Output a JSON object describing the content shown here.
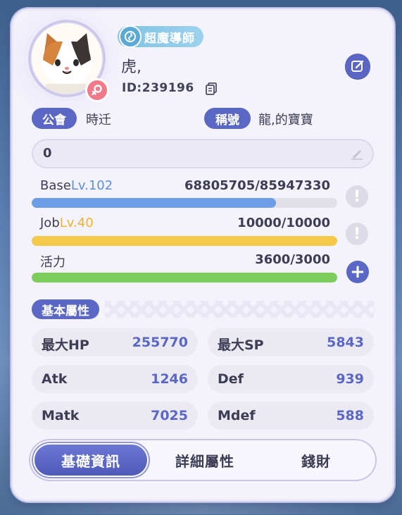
{
  "profile": {
    "job_title": "超魔導師",
    "name": "虎,",
    "id_text": "ID:239196",
    "gender": "female"
  },
  "guild": {
    "label": "公會",
    "value": "時迁"
  },
  "title": {
    "label": "稱號",
    "value": "龍,的寶寶"
  },
  "signature": {
    "text": "0"
  },
  "stats": {
    "base": {
      "label": "Base",
      "level_text": "Lv.102",
      "value_text": "68805705/85947330",
      "progress": 0.8,
      "color": "#6c9de6"
    },
    "job": {
      "label": "Job",
      "level_text": "Lv.40",
      "value_text": "10000/10000",
      "progress": 1.0,
      "color": "#f4c94a"
    },
    "stamina": {
      "label": "活力",
      "value_text": "3600/3000",
      "progress": 1.0,
      "color": "#7ccd5c"
    }
  },
  "section": {
    "title": "基本屬性"
  },
  "attributes": [
    {
      "name": "最大HP",
      "value": "255770"
    },
    {
      "name": "最大SP",
      "value": "5843"
    },
    {
      "name": "Atk",
      "value": "1246"
    },
    {
      "name": "Def",
      "value": "939"
    },
    {
      "name": "Matk",
      "value": "7025"
    },
    {
      "name": "Mdef",
      "value": "588"
    }
  ],
  "tabs": [
    {
      "label": "基礎資訊",
      "active": true
    },
    {
      "label": "詳細屬性",
      "active": false
    },
    {
      "label": "錢財",
      "active": false
    }
  ],
  "icons": {
    "edit": "edit-icon",
    "copy": "copy-icon",
    "pencil": "pencil-icon",
    "info": "exclamation-icon",
    "plus": "plus-icon",
    "gender": "female-icon",
    "job": "rose-icon"
  },
  "colors": {
    "accent": "#5b67c4",
    "job_pill": "#8ccbea",
    "gender": "#f07a8a"
  }
}
